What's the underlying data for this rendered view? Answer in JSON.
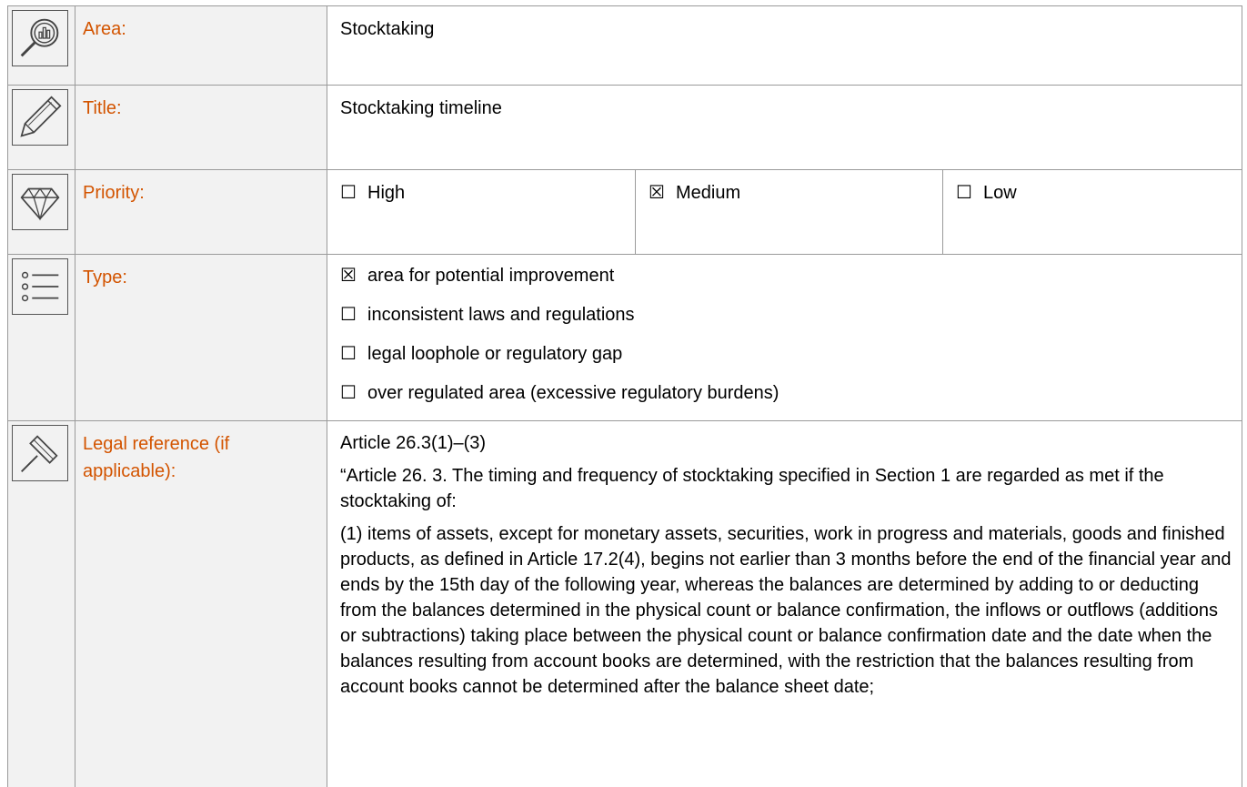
{
  "rows": {
    "area": {
      "label": "Area:",
      "value": "Stocktaking",
      "icon": "magnifier-chart-icon"
    },
    "title": {
      "label": "Title:",
      "value": "Stocktaking timeline",
      "icon": "pencil-icon"
    },
    "priority": {
      "label": "Priority:",
      "icon": "diamond-icon",
      "options": [
        {
          "box": "☐",
          "text": "High"
        },
        {
          "box": "☒",
          "text": "Medium"
        },
        {
          "box": "☐",
          "text": "Low"
        }
      ]
    },
    "type": {
      "label": "Type:",
      "icon": "list-icon",
      "options": [
        {
          "box": "☒",
          "text": "area for potential improvement"
        },
        {
          "box": "☐",
          "text": "inconsistent laws and regulations"
        },
        {
          "box": "☐",
          "text": "legal loophole or regulatory gap"
        },
        {
          "box": "☐",
          "text": "over regulated area (excessive regulatory burdens)"
        }
      ]
    },
    "legal": {
      "label": "Legal reference (if applicable):",
      "icon": "gavel-icon",
      "paragraphs": [
        "Article 26.3(1)–(3)",
        "“Article 26. 3. The timing and frequency of stocktaking specified in Section 1 are regarded as met if the stocktaking of:",
        "(1) items of assets, except for monetary assets, securities, work in progress and materials, goods and finished products, as defined in Article 17.2(4), begins not earlier than 3 months before the end of the financial year and ends by the 15th day of the following year, whereas the balances are determined by adding to or deducting from the balances determined in the physical count or balance confirmation, the inflows or outflows (additions or subtractions) taking place between the physical count or balance confirmation date and the date when the balances resulting from account books are determined, with the restriction that the balances resulting from account books cannot be determined after the balance sheet date;"
      ]
    }
  }
}
